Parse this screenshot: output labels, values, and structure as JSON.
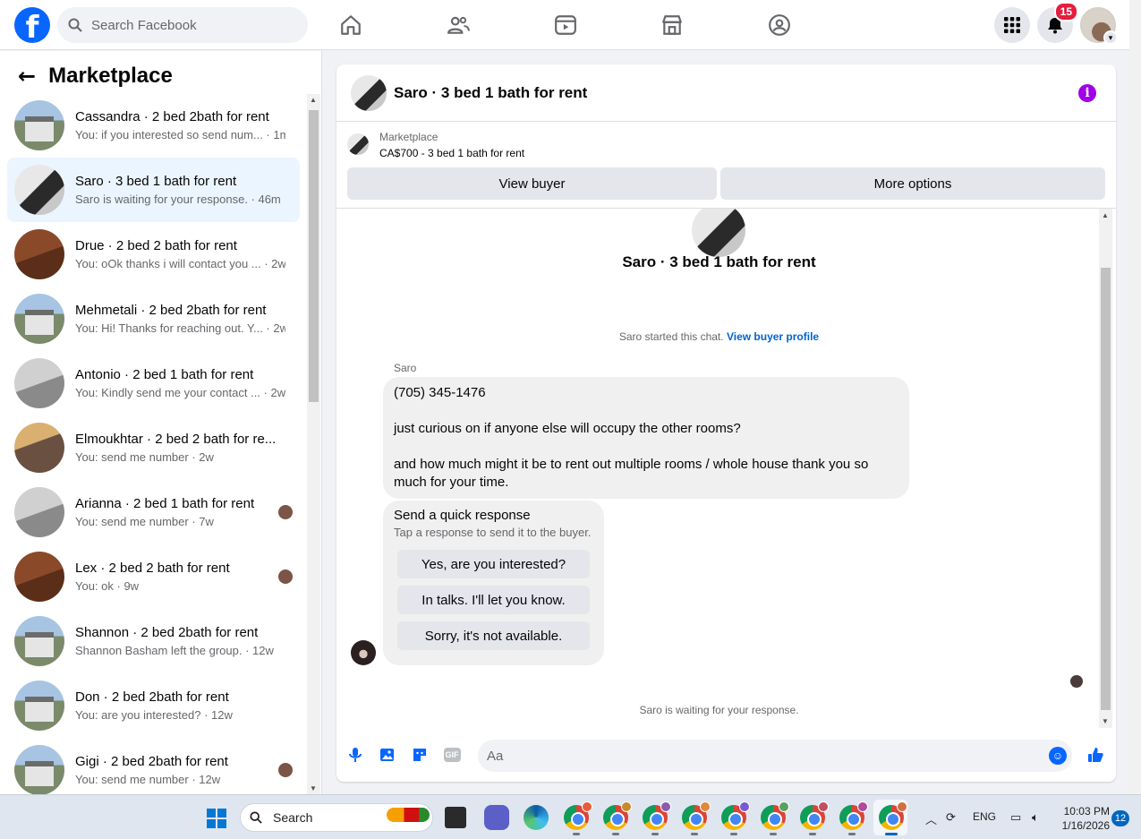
{
  "topbar": {
    "search_placeholder": "Search Facebook",
    "notification_count": "15",
    "accent": "#0866ff"
  },
  "left": {
    "title": "Marketplace",
    "conversations": [
      {
        "name": "Cassandra · 2 bed 2bath for rent",
        "preview": "You: if you interested so send num... · 1m",
        "thumb": "house"
      },
      {
        "name": "Saro · 3 bed 1 bath for rent",
        "preview": "Saro is waiting for your response. · 46m",
        "thumb": "kitchen"
      },
      {
        "name": "Drue · 2 bed 2 bath for rent",
        "preview": "You: oOk thanks i will contact you ... · 2w",
        "thumb": "wood"
      },
      {
        "name": "Mehmetali · 2 bed 2bath for rent",
        "preview": "You: Hi! Thanks for reaching out. Y... · 2w",
        "thumb": "house"
      },
      {
        "name": "Antonio · 2 bed 1 bath for rent",
        "preview": "You: Kindly send me your contact ... · 2w",
        "thumb": "gray"
      },
      {
        "name": "Elmoukhtar · 2 bed 2 bath for re...",
        "preview": "You: send me number · 2w",
        "thumb": "warm"
      },
      {
        "name": "Arianna · 2 bed 1 bath for rent",
        "preview": "You: send me number · 7w",
        "thumb": "gray"
      },
      {
        "name": "Lex · 2 bed 2 bath for rent",
        "preview": "You: ok · 9w",
        "thumb": "wood"
      },
      {
        "name": "Shannon · 2 bed 2bath for rent",
        "preview": "Shannon Basham left the group. · 12w",
        "thumb": "house"
      },
      {
        "name": "Don · 2 bed 2bath for rent",
        "preview": "You: are you interested? · 12w",
        "thumb": "house"
      },
      {
        "name": "Gigi · 2 bed 2bath for rent",
        "preview": "You: send me number · 12w",
        "thumb": "house"
      }
    ]
  },
  "chat": {
    "title": "Saro · 3 bed 1 bath for rent",
    "listing_label": "Marketplace",
    "listing_price": "CA$700 - 3 bed 1 bath for rent",
    "view_buyer": "View buyer",
    "more_options": "More options",
    "center_name": "Saro · 3 bed 1 bath for rent",
    "started_text": "Saro started this chat.",
    "view_profile": "View buyer profile",
    "sender": "Saro",
    "message_lines": [
      "(705) 345-1476",
      "just curious on if anyone else will occupy the other rooms?",
      "and how much might it be to rent out multiple rooms / whole house thank you so much for your time."
    ],
    "quick_title": "Send a quick response",
    "quick_sub": "Tap a response to send it to the buyer.",
    "quick_options": [
      "Yes, are you interested?",
      "In talks. I'll let you know.",
      "Sorry, it's not available."
    ],
    "waiting": "Saro is waiting for your response.",
    "input_placeholder": "Aa",
    "gif_label": "GIF"
  },
  "taskbar": {
    "search_label": "Search",
    "lang": "ENG",
    "time": "10:03 PM",
    "date": "1/16/2026",
    "notifications": "12"
  }
}
